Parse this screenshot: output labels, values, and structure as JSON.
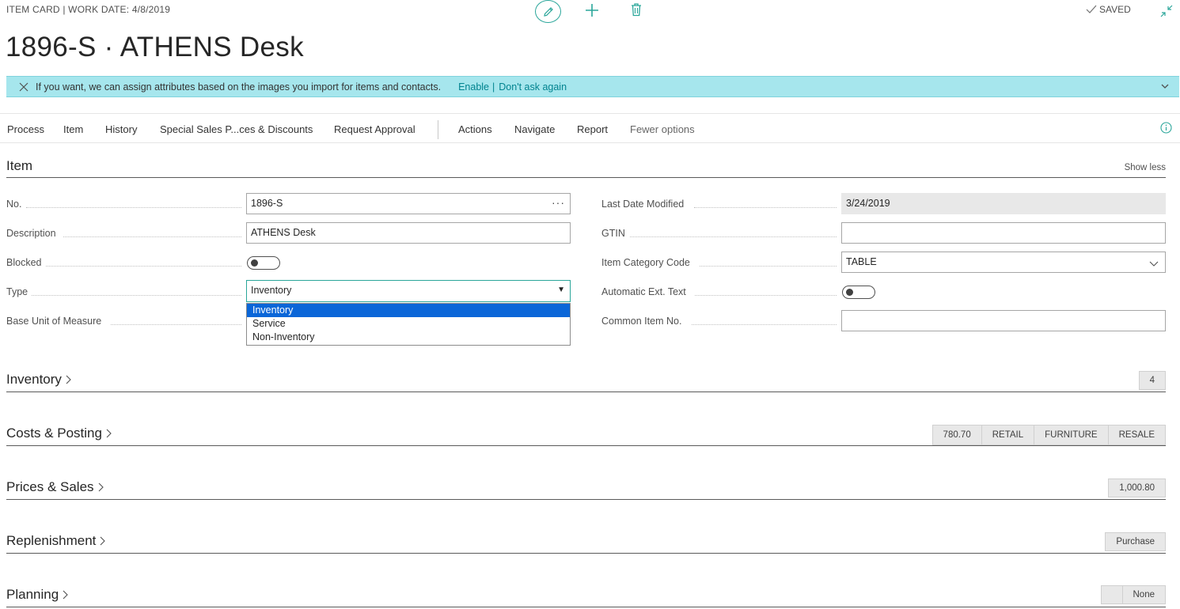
{
  "header": {
    "breadcrumb": "ITEM CARD | WORK DATE: 4/8/2019",
    "saved_label": "SAVED",
    "title": "1896-S · ATHENS Desk"
  },
  "notification": {
    "message": "If you want, we can assign attributes based on the images you import for items and contacts.",
    "enable": "Enable",
    "separator": "|",
    "dont_ask": "Don't ask again"
  },
  "action_bar": {
    "items": [
      "Process",
      "Item",
      "History",
      "Special Sales P...ces & Discounts",
      "Request Approval",
      "Actions",
      "Navigate",
      "Report",
      "Fewer options"
    ]
  },
  "item_section": {
    "title": "Item",
    "show_less": "Show less",
    "fields_left": [
      {
        "label": "No.",
        "value": "1896-S"
      },
      {
        "label": "Description",
        "value": "ATHENS Desk"
      },
      {
        "label": "Blocked",
        "toggle": false
      },
      {
        "label": "Type",
        "value": "Inventory"
      },
      {
        "label": "Base Unit of Measure",
        "value": ""
      }
    ],
    "fields_right": [
      {
        "label": "Last Date Modified",
        "value": "3/24/2019"
      },
      {
        "label": "GTIN",
        "value": ""
      },
      {
        "label": "Item Category Code",
        "value": "TABLE"
      },
      {
        "label": "Automatic Ext. Text",
        "toggle": false
      },
      {
        "label": "Common Item No.",
        "value": ""
      }
    ],
    "type_options": [
      "Inventory",
      "Service",
      "Non-Inventory"
    ],
    "type_selected": "Inventory"
  },
  "sections": [
    {
      "title": "Inventory",
      "chips": [
        "4"
      ]
    },
    {
      "title": "Costs & Posting",
      "chips": [
        "780.70",
        "RETAIL",
        "FURNITURE",
        "RESALE"
      ]
    },
    {
      "title": "Prices & Sales",
      "chips": [
        "1,000.80"
      ]
    },
    {
      "title": "Replenishment",
      "chips": [
        "Purchase"
      ]
    },
    {
      "title": "Planning",
      "chips": [
        "",
        "None"
      ]
    }
  ],
  "colors": {
    "accent": "#2aa69a",
    "notification_bg": "#a6e6ed",
    "link": "#00838f",
    "dropdown_highlight": "#0a66d8"
  }
}
